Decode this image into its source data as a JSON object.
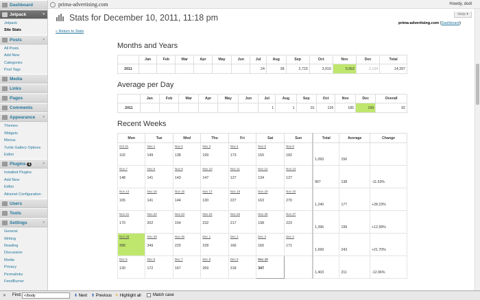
{
  "topbar": {
    "site": "prima-advertising.com",
    "howdy": "Howdy, dodi",
    "help": "Help ▾"
  },
  "sidebar": {
    "dashboard": "Dashboard",
    "jetpack": "Jetpack",
    "jetpack_subs": [
      "Jetpack",
      "Site Stats"
    ],
    "posts": "Posts",
    "posts_subs": [
      "All Posts",
      "Add New",
      "Categories",
      "Post Tags"
    ],
    "media": "Media",
    "links": "Links",
    "pages": "Pages",
    "comments": "Comments",
    "appearance": "Appearance",
    "appearance_subs": [
      "Themes",
      "Widgets",
      "Menus",
      "Turtle Gallery Options",
      "Editor"
    ],
    "plugins": "Plugins",
    "plugins_badge": "1",
    "plugins_subs": [
      "Installed Plugins",
      "Add New",
      "Editor",
      "Akismet Configuration"
    ],
    "users": "Users",
    "tools": "Tools",
    "settings": "Settings",
    "settings_subs": [
      "General",
      "Writing",
      "Reading",
      "Discussion",
      "Media",
      "Privacy",
      "Permalinks",
      "FeedBurner"
    ]
  },
  "page": {
    "title": "Stats for December 10, 2011, 11:18 pm",
    "back": "« Return to Stats",
    "site_name": "prima-advertising.com",
    "site_link": "Dashboard"
  },
  "months": {
    "title": "Months and Years",
    "headers": [
      "",
      "Jan",
      "Feb",
      "Mar",
      "Apr",
      "May",
      "Jun",
      "Jul",
      "Aug",
      "Sep",
      "Oct",
      "Nov",
      "Dec",
      "Total"
    ],
    "row": [
      "2011",
      "",
      "",
      "",
      "",
      "",
      "",
      "24",
      "38",
      "2,723",
      "3,916",
      "5,562",
      "2,134",
      "14,397"
    ]
  },
  "average": {
    "title": "Average per Day",
    "headers": [
      "",
      "Jan",
      "Feb",
      "Mar",
      "Apr",
      "May",
      "Jun",
      "Jul",
      "Aug",
      "Sep",
      "Oct",
      "Nov",
      "Dec",
      "Overall"
    ],
    "row": [
      "2011",
      "",
      "",
      "",
      "",
      "",
      "",
      "1",
      "1",
      "91",
      "126",
      "185",
      "199",
      "92"
    ]
  },
  "weeks": {
    "title": "Recent Weeks",
    "headers": [
      "Mon",
      "Tue",
      "Wed",
      "Thu",
      "Fri",
      "Sat",
      "Sun",
      "Total",
      "Average",
      "Change"
    ],
    "rows": [
      {
        "days": [
          [
            "Oct 31",
            "102"
          ],
          [
            "Nov 1",
            "149"
          ],
          [
            "Nov 2",
            "138"
          ],
          [
            "Nov 3",
            "199"
          ],
          [
            "Nov 4",
            "173"
          ],
          [
            "Nov 5",
            "150"
          ],
          [
            "Nov 6",
            "182"
          ]
        ],
        "total": "1,093",
        "avg": "156",
        "change": ""
      },
      {
        "days": [
          [
            "Nov 7",
            "148"
          ],
          [
            "Nov 8",
            "141"
          ],
          [
            "Nov 9",
            "143"
          ],
          [
            "Nov 10",
            "147"
          ],
          [
            "Nov 11",
            "127"
          ],
          [
            "Nov 12",
            "134"
          ],
          [
            "Nov 13",
            "127"
          ]
        ],
        "total": "967",
        "avg": "138",
        "change": "-11.53%"
      },
      {
        "days": [
          [
            "Nov 14",
            "165"
          ],
          [
            "Nov 15",
            "141"
          ],
          [
            "Nov 16",
            "144"
          ],
          [
            "Nov 17",
            "130"
          ],
          [
            "Nov 18",
            "227"
          ],
          [
            "Nov 19",
            "163"
          ],
          [
            "Nov 20",
            "270"
          ]
        ],
        "total": "1,240",
        "avg": "177",
        "change": "+28.23%"
      },
      {
        "days": [
          [
            "Nov 21",
            "170"
          ],
          [
            "Nov 22",
            "202"
          ],
          [
            "Nov 23",
            "154"
          ],
          [
            "Nov 24",
            "232"
          ],
          [
            "Nov 25",
            "217"
          ],
          [
            "Nov 26",
            "198"
          ],
          [
            "Nov 27",
            "223"
          ]
        ],
        "total": "1,396",
        "avg": "199",
        "change": "+12.58%"
      },
      {
        "days": [
          [
            "Nov 28",
            "399"
          ],
          [
            "Nov 29",
            "349"
          ],
          [
            "Nov 30",
            "220"
          ],
          [
            "Dec 1",
            "228"
          ],
          [
            "Dec 2",
            "166"
          ],
          [
            "Dec 3",
            "166"
          ],
          [
            "Dec 4",
            "171"
          ]
        ],
        "total": "1,699",
        "avg": "243",
        "change": "+21.70%"
      },
      {
        "days": [
          [
            "Dec 5",
            "130"
          ],
          [
            "Dec 6",
            "172"
          ],
          [
            "Dec 7",
            "167"
          ],
          [
            "Dec 8",
            "269"
          ],
          [
            "Dec 9",
            "318"
          ],
          [
            "Dec 10",
            "347"
          ],
          [
            "",
            ""
          ]
        ],
        "total": "1,403",
        "avg": "211",
        "change": "-12.96%"
      }
    ]
  },
  "findbar": {
    "label": "Find:",
    "value": "</body",
    "next": "Next",
    "previous": "Previous",
    "highlight": "Highlight all",
    "match": "Match case"
  }
}
